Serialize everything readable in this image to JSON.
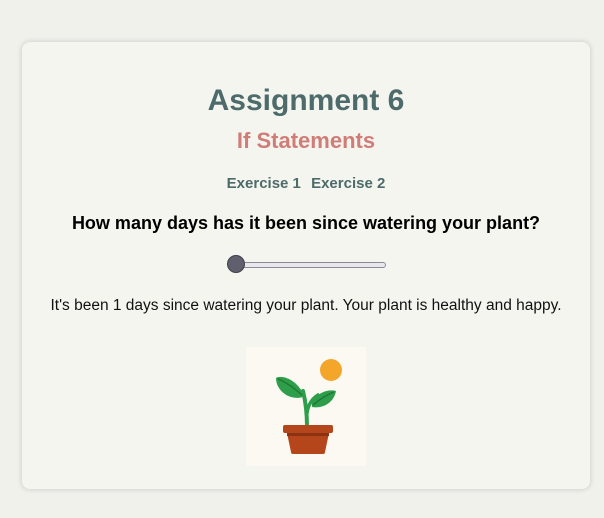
{
  "header": {
    "title": "Assignment 6",
    "subtitle": "If Statements"
  },
  "nav": {
    "items": [
      "Exercise 1",
      "Exercise 2"
    ]
  },
  "question": "How many days has it been since watering your plant?",
  "slider": {
    "value": 1,
    "fraction": 0.0
  },
  "status_text": "It's been 1 days since watering your plant. Your plant is healthy and happy.",
  "plant": {
    "icon": "healthy-plant-icon"
  },
  "colors": {
    "title": "#4d6b6b",
    "subtitle": "#d07d78",
    "pot": "#b5451b",
    "leaf": "#2e9e4a",
    "sun": "#f4a62a"
  }
}
